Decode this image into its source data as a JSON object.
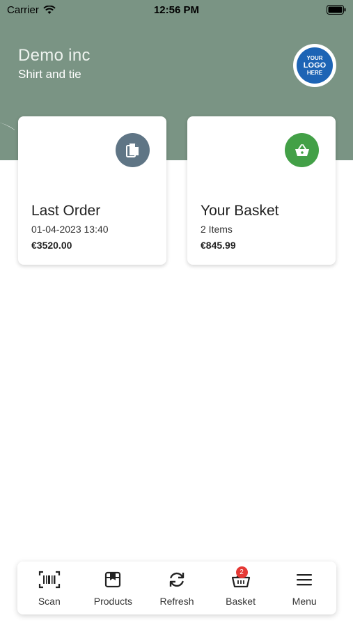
{
  "status_bar": {
    "carrier": "Carrier",
    "time": "12:56 PM"
  },
  "header": {
    "company": "Demo inc",
    "subtitle": "Shirt and tie",
    "logo": {
      "line1": "YOUR",
      "line2": "LOGO",
      "line3": "HERE"
    },
    "bg_color": "#7a9484"
  },
  "cards": {
    "last_order": {
      "title": "Last Order",
      "date": "01-04-2023 13:40",
      "amount": "€3520.00",
      "icon": "document-icon",
      "icon_color": "#5f7585"
    },
    "basket": {
      "title": "Your Basket",
      "items": "2 Items",
      "amount": "€845.99",
      "icon": "basket-icon",
      "icon_color": "#43a047"
    }
  },
  "tabbar": {
    "items": [
      {
        "label": "Scan",
        "icon": "barcode-icon"
      },
      {
        "label": "Products",
        "icon": "box-icon"
      },
      {
        "label": "Refresh",
        "icon": "refresh-icon"
      },
      {
        "label": "Basket",
        "icon": "basket-icon",
        "badge": "2"
      },
      {
        "label": "Menu",
        "icon": "menu-icon"
      }
    ]
  }
}
